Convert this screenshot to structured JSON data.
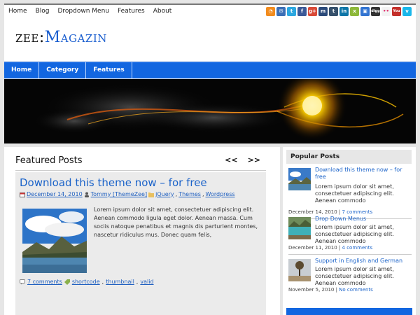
{
  "topnav": {
    "items": [
      "Home",
      "Blog",
      "Dropdown Menu",
      "Features",
      "About"
    ]
  },
  "social": [
    {
      "name": "rss-icon",
      "glyph": "◔",
      "color": "#f28c1e"
    },
    {
      "name": "email-icon",
      "glyph": "✉",
      "color": "#3b6fb6"
    },
    {
      "name": "twitter-icon",
      "glyph": "t",
      "color": "#2ca7e0"
    },
    {
      "name": "facebook-icon",
      "glyph": "f",
      "color": "#3b5998"
    },
    {
      "name": "googleplus-icon",
      "glyph": "g+",
      "color": "#d94a38"
    },
    {
      "name": "myspace-icon",
      "glyph": "m",
      "color": "#2b4a7a"
    },
    {
      "name": "tumblr-icon",
      "glyph": "t",
      "color": "#35506b"
    },
    {
      "name": "linkedin-icon",
      "glyph": "in",
      "color": "#0e76a8"
    },
    {
      "name": "xing-icon",
      "glyph": "x",
      "color": "#8db83a"
    },
    {
      "name": "delicious-icon",
      "glyph": "▣",
      "color": "#3274d1"
    },
    {
      "name": "digg-icon",
      "glyph": "digg",
      "color": "#333"
    },
    {
      "name": "flickr-icon",
      "glyph": "••",
      "color": "#f3f3f3"
    },
    {
      "name": "youtube-icon",
      "glyph": "You",
      "color": "#c4302b"
    },
    {
      "name": "vimeo-icon",
      "glyph": "v",
      "color": "#1ab7ea"
    }
  ],
  "logo": {
    "part1": "zee:",
    "part2": "Magazin"
  },
  "mainnav": {
    "items": [
      "Home",
      "Category",
      "Features"
    ]
  },
  "featured": {
    "heading": "Featured Posts",
    "prev": "<<",
    "next": ">>",
    "post": {
      "title": "Download this theme now – for free",
      "date": "December 14, 2010",
      "author": "Tommy [ThemeZee]",
      "cat1": "jQuery",
      "cat2": "Themes",
      "cat3": "Wordpress",
      "excerpt": "Lorem ipsum dolor sit amet, consectetuer adipiscing elit. Aenean commodo ligula eget dolor. Aenean massa. Cum sociis natoque penatibus et magnis dis parturient montes, nascetur ridiculus mus. Donec quam felis,",
      "comments": "7 comments",
      "tag1": "shortcode",
      "tag2": "thumbnail",
      "tag3": "valid"
    }
  },
  "popular": {
    "heading": "Popular Posts",
    "items": [
      {
        "title": "Download this theme now – for free",
        "text": "Lorem ipsum dolor sit amet, consectetuer adipiscing elit. Aenean commodo",
        "date": "December 14, 2010",
        "comments": "7 comments"
      },
      {
        "title": "Drop Down Menus",
        "text": "Lorem ipsum dolor sit amet, consectetuer adipiscing elit. Aenean commodo",
        "date": "December 11, 2010",
        "comments": "4 comments"
      },
      {
        "title": "Support in English and German",
        "text": "Lorem ipsum dolor sit amet, consectetuer adipiscing elit. Aenean commodo",
        "date": "November 5, 2010",
        "comments": "No comments"
      }
    ]
  }
}
